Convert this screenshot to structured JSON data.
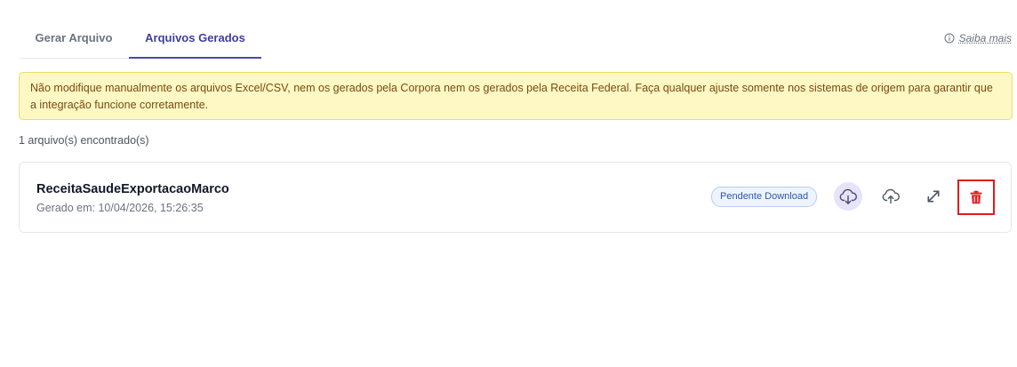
{
  "tabs": [
    {
      "label": "Gerar Arquivo",
      "active": false
    },
    {
      "label": "Arquivos Gerados",
      "active": true
    }
  ],
  "help": {
    "icon": "info-icon",
    "label": "Saiba mais"
  },
  "warning": {
    "text": "Não modifique manualmente os arquivos Excel/CSV, nem os gerados pela Corpora nem os gerados pela Receita Federal. Faça qualquer ajuste somente nos sistemas de origem para garantir que a integração funcione corretamente."
  },
  "results": {
    "count_text": "1 arquivo(s) encontrado(s)"
  },
  "files": [
    {
      "name": "ReceitaSaudeExportacaoMarco",
      "generated": "Gerado em: 10/04/2026, 15:26:35",
      "status": "Pendente Download",
      "actions": [
        "cloud-download-icon",
        "cloud-upload-icon",
        "expand-icon",
        "trash-icon"
      ]
    }
  ],
  "colors": {
    "accent": "#4b49ac",
    "warning_bg": "#fdf8c4",
    "warning_border": "#f2dc6b",
    "badge_text": "#2b5aa8",
    "danger": "#e11d1d"
  }
}
